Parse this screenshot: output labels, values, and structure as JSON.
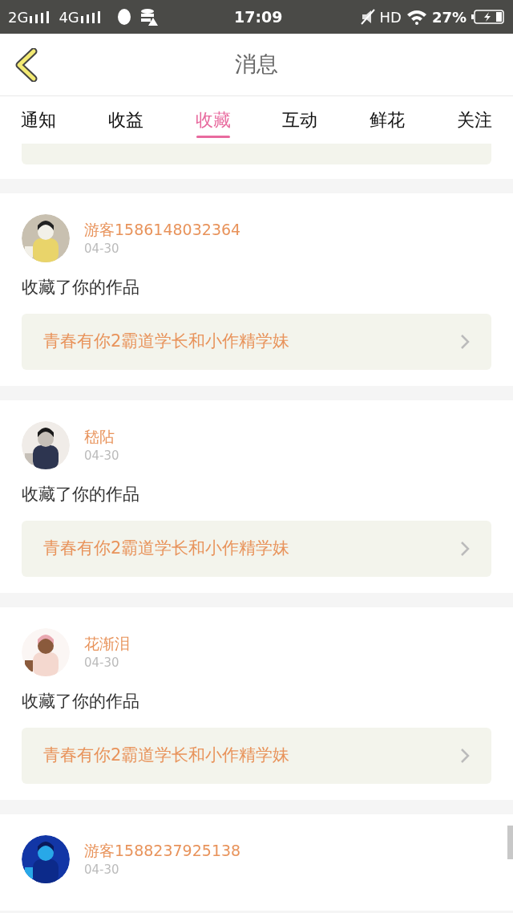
{
  "status_bar": {
    "network_1": "2G",
    "network_2": "4G",
    "time": "17:09",
    "hd": "HD",
    "battery": "27%"
  },
  "header": {
    "title": "消息"
  },
  "tabs": [
    {
      "label": "通知",
      "selected": false
    },
    {
      "label": "收益",
      "selected": false
    },
    {
      "label": "收藏",
      "selected": true
    },
    {
      "label": "互动",
      "selected": false
    },
    {
      "label": "鲜花",
      "selected": false
    },
    {
      "label": "关注",
      "selected": false
    }
  ],
  "messages": [
    {
      "user": "游客1586148032364",
      "date": "04-30",
      "action": "收藏了你的作品",
      "work": "青春有你2霸道学长和小作精学妹"
    },
    {
      "user": "嵇阽",
      "date": "04-30",
      "action": "收藏了你的作品",
      "work": "青春有你2霸道学长和小作精学妹"
    },
    {
      "user": "花渐泪",
      "date": "04-30",
      "action": "收藏了你的作品",
      "work": "青春有你2霸道学长和小作精学妹"
    },
    {
      "user": "游客1588237925138",
      "date": "04-30"
    }
  ]
}
